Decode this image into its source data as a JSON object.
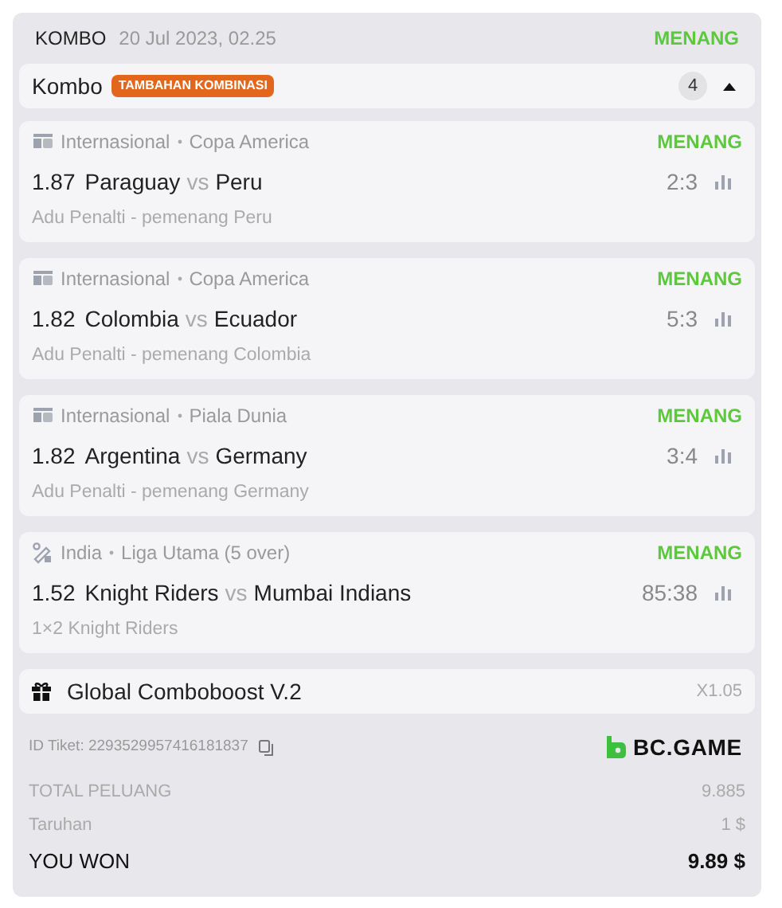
{
  "header": {
    "type": "KOMBO",
    "date": "20 Jul 2023, 02.25",
    "status": "MENANG"
  },
  "combo": {
    "title": "Kombo",
    "badge": "TAMBAHAN KOMBINASI",
    "count": "4",
    "expanded": true
  },
  "legs": [
    {
      "kind": "esport",
      "category": "Internasional",
      "league": "Copa America",
      "result": "MENANG",
      "odds": "1.87",
      "home": "Paraguay",
      "separator": "vs",
      "away": "Peru",
      "score": "2:3",
      "market": "Adu Penalti - pemenang Peru"
    },
    {
      "kind": "esport",
      "category": "Internasional",
      "league": "Copa America",
      "result": "MENANG",
      "odds": "1.82",
      "home": "Colombia",
      "separator": "vs",
      "away": "Ecuador",
      "score": "5:3",
      "market": "Adu Penalti - pemenang Colombia"
    },
    {
      "kind": "esport",
      "category": "Internasional",
      "league": "Piala Dunia",
      "result": "MENANG",
      "odds": "1.82",
      "home": "Argentina",
      "separator": "vs",
      "away": "Germany",
      "score": "3:4",
      "market": "Adu Penalti - pemenang Germany"
    },
    {
      "kind": "cricket",
      "category": "India",
      "league": "Liga Utama (5 over)",
      "result": "MENANG",
      "odds": "1.52",
      "home": "Knight Riders",
      "separator": "vs",
      "away": "Mumbai Indians",
      "score": "85:38",
      "market": "1×2 Knight Riders"
    }
  ],
  "boost": {
    "title": "Global Comboboost V.2",
    "multiplier": "X1.05"
  },
  "ticket": {
    "id": "ID Tiket: 2293529957416181837",
    "brand": "BC.GAME"
  },
  "totals": [
    {
      "kind": "muted",
      "label": "TOTAL PELUANG",
      "value": "9.885"
    },
    {
      "kind": "muted",
      "label": "Taruhan",
      "value": "1 $"
    },
    {
      "kind": "strong",
      "label": "YOU WON",
      "value": "9.89 $"
    }
  ]
}
